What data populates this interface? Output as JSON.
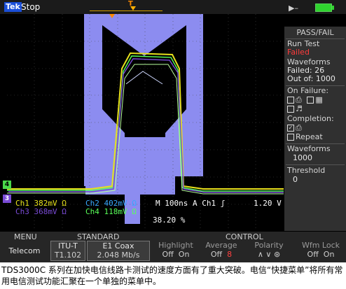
{
  "header": {
    "brand": "Tek",
    "acq_state": "Stop",
    "trigger_marker": "T"
  },
  "scope": {
    "trigger_pos_marker": "T",
    "channel_markers": {
      "ch4": "4",
      "ch3": "3"
    }
  },
  "readout": {
    "ch1": "Ch1  382mV Ω",
    "ch2": "Ch2  402mV Ω",
    "ch3": "Ch3  368mV Ω",
    "ch4": "Ch4  118mV Ω",
    "timebase": "M 100ns  A  Ch1  ʃ",
    "trigger_level": "1.20 V",
    "trigger_position": "38.20 %"
  },
  "side_panel": {
    "title": "PASS/FAIL",
    "run_test_label": "Run Test",
    "run_test_value": "Failed",
    "waveforms_label": "Waveforms",
    "failed_line": "Failed:  26",
    "outof_line": "Out of: 1000",
    "on_failure_label": "On Failure:",
    "completion_label": "Completion:",
    "repeat_label": "Repeat",
    "waveforms_setting_label": "Waveforms",
    "waveforms_setting_value": "1000",
    "threshold_label": "Threshold",
    "threshold_value": "0"
  },
  "menu": {
    "menu_heading": "MENU",
    "standard_heading": "STANDARD",
    "control_heading": "CONTROL",
    "telecom": "Telecom",
    "itu_label": "ITU-T",
    "itu_value": "T1.102",
    "e1_label": "E1 Coax",
    "e1_value": "2.048 Mb/s",
    "highlight_label": "Highlight",
    "highlight_off": "Off",
    "highlight_on": "On",
    "average_label": "Average",
    "average_off": "Off",
    "average_value": "8",
    "polarity_label": "Polarity",
    "wfmlock_label": "Wfm Lock",
    "wfmlock_off": "Off",
    "wfmlock_on": "On"
  },
  "caption": "TDS3000C 系列在加快电信线路卡测试的速度方面有了重大突破。电信“快捷菜单”将所有常用电信测试功能汇聚在一个单独的菜单中。",
  "colors": {
    "mask": "#8c8cf0",
    "ch1": "#e7e21c",
    "ch2": "#38a8ff",
    "ch4": "#59ff59",
    "ch3": "#7a4bd6",
    "fail": "#ff3b3b",
    "brand": "#1b4fd8"
  }
}
